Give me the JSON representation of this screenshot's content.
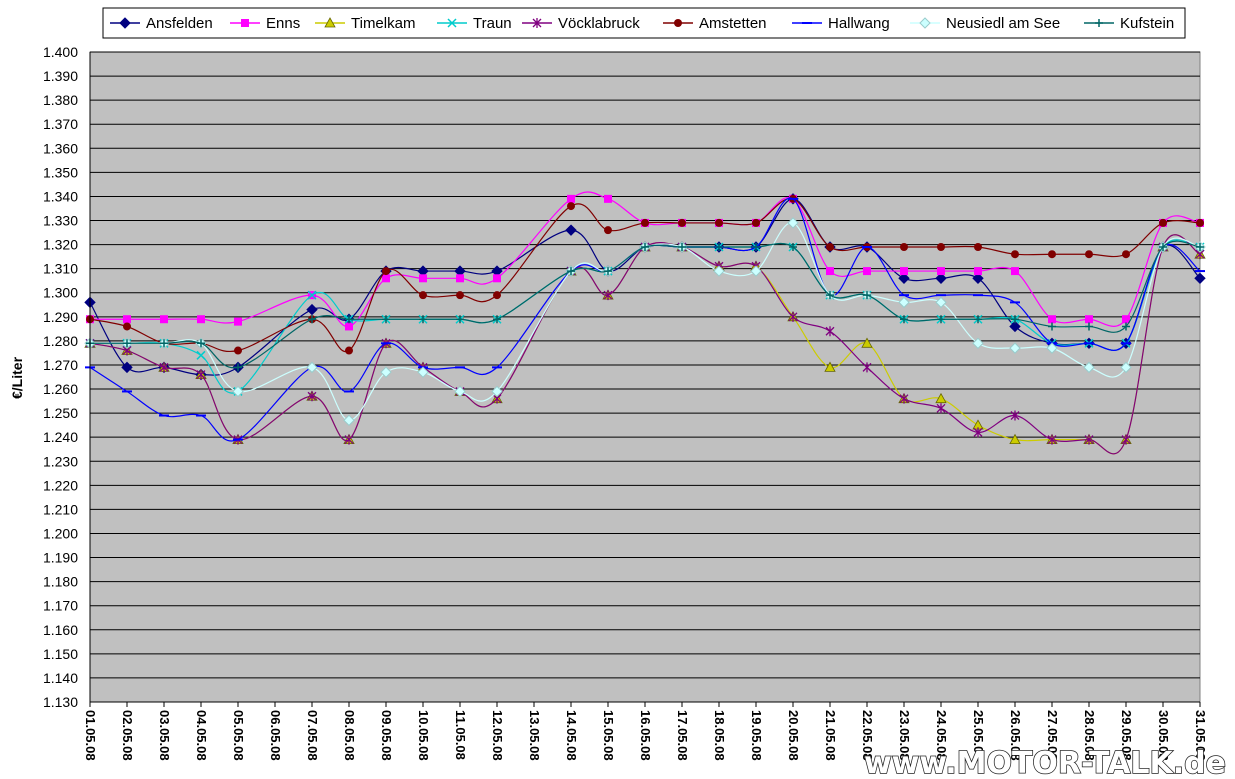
{
  "chart_data": {
    "type": "line",
    "title": "",
    "xlabel": "",
    "ylabel": "€/Liter",
    "ylim": [
      1.13,
      1.4
    ],
    "y_step": 0.01,
    "grid": true,
    "legend": "top",
    "watermark": "www.MOTOR-TALK.de",
    "x": [
      "01.05.08",
      "02.05.08",
      "03.05.08",
      "04.05.08",
      "05.05.08",
      "06.05.08",
      "07.05.08",
      "08.05.08",
      "09.05.08",
      "10.05.08",
      "11.05.08",
      "12.05.08",
      "13.05.08",
      "14.05.08",
      "15.05.08",
      "16.05.08",
      "17.05.08",
      "18.05.08",
      "19.05.08",
      "20.05.08",
      "21.05.08",
      "22.05.08",
      "23.05.08",
      "24.05.08",
      "25.05.08",
      "26.05.08",
      "27.05.08",
      "28.05.08",
      "29.05.08",
      "30.05.08",
      "31.05.08"
    ],
    "series": [
      {
        "name": "Ansfelden",
        "color": "#000080",
        "marker": "diamond",
        "values": [
          1.296,
          1.269,
          1.269,
          1.266,
          1.269,
          null,
          1.293,
          1.289,
          1.309,
          1.309,
          1.309,
          1.309,
          null,
          1.326,
          1.309,
          1.319,
          1.319,
          1.319,
          1.319,
          1.339,
          1.319,
          1.319,
          1.306,
          1.306,
          1.306,
          1.286,
          1.279,
          1.279,
          1.279,
          1.319,
          1.306
        ]
      },
      {
        "name": "Enns",
        "color": "#ff00ff",
        "marker": "square",
        "values": [
          1.289,
          1.289,
          1.289,
          1.289,
          1.288,
          null,
          1.299,
          1.286,
          1.306,
          1.306,
          1.306,
          1.306,
          null,
          1.339,
          1.339,
          1.329,
          1.329,
          1.329,
          1.329,
          1.339,
          1.309,
          1.309,
          1.309,
          1.309,
          1.309,
          1.309,
          1.289,
          1.289,
          1.289,
          1.329,
          1.329
        ]
      },
      {
        "name": "Timelkam",
        "color": "#cccc00",
        "marker": "triangle",
        "values": [
          1.279,
          1.276,
          1.269,
          1.266,
          1.239,
          null,
          1.257,
          1.239,
          1.279,
          1.269,
          1.259,
          1.256,
          null,
          1.309,
          1.299,
          1.319,
          1.319,
          1.311,
          1.311,
          1.29,
          1.269,
          1.279,
          1.256,
          1.256,
          1.245,
          1.239,
          1.239,
          1.239,
          1.239,
          1.319,
          1.316
        ]
      },
      {
        "name": "Traun",
        "color": "#00cccc",
        "marker": "x",
        "values": [
          1.279,
          1.279,
          1.279,
          1.274,
          1.259,
          null,
          1.299,
          1.289,
          1.289,
          1.289,
          1.289,
          1.289,
          null,
          1.309,
          1.309,
          1.319,
          1.319,
          1.319,
          1.319,
          1.319,
          1.299,
          1.299,
          1.289,
          1.289,
          1.289,
          1.289,
          1.279,
          1.279,
          1.279,
          1.319,
          1.319
        ]
      },
      {
        "name": "Vöcklabruck",
        "color": "#800080",
        "marker": "star",
        "values": [
          1.279,
          1.276,
          1.269,
          1.266,
          1.239,
          null,
          1.257,
          1.239,
          1.279,
          1.269,
          1.259,
          1.256,
          null,
          1.309,
          1.299,
          1.319,
          1.319,
          1.311,
          1.311,
          1.29,
          1.284,
          1.269,
          1.256,
          1.252,
          1.242,
          1.249,
          1.239,
          1.239,
          1.239,
          1.319,
          1.316
        ]
      },
      {
        "name": "Amstetten",
        "color": "#800000",
        "marker": "circle",
        "values": [
          1.289,
          1.286,
          1.279,
          1.279,
          1.276,
          null,
          1.289,
          1.276,
          1.309,
          1.299,
          1.299,
          1.299,
          null,
          1.336,
          1.326,
          1.329,
          1.329,
          1.329,
          1.329,
          1.339,
          1.319,
          1.319,
          1.319,
          1.319,
          1.319,
          1.316,
          1.316,
          1.316,
          1.316,
          1.329,
          1.329
        ]
      },
      {
        "name": "Hallwang",
        "color": "#0000ff",
        "marker": "dash",
        "values": [
          1.269,
          1.259,
          1.249,
          1.249,
          1.239,
          null,
          1.269,
          1.259,
          1.279,
          1.269,
          1.269,
          1.269,
          null,
          1.309,
          1.309,
          1.319,
          1.319,
          1.319,
          1.319,
          1.339,
          1.299,
          1.319,
          1.299,
          1.299,
          1.299,
          1.296,
          1.279,
          1.279,
          1.279,
          1.319,
          1.309
        ]
      },
      {
        "name": "Neusiedl am See",
        "color": "#ccffff",
        "marker": "diamond",
        "values": [
          1.279,
          1.279,
          1.279,
          1.279,
          1.259,
          null,
          1.269,
          1.247,
          1.267,
          1.267,
          1.259,
          1.259,
          null,
          1.309,
          1.309,
          1.319,
          1.319,
          1.309,
          1.309,
          1.329,
          1.299,
          1.299,
          1.296,
          1.296,
          1.279,
          1.277,
          1.277,
          1.269,
          1.269,
          1.319,
          1.319
        ]
      },
      {
        "name": "Kufstein",
        "color": "#006666",
        "marker": "plus",
        "values": [
          1.279,
          1.279,
          1.279,
          1.279,
          1.269,
          null,
          1.289,
          1.289,
          1.289,
          1.289,
          1.289,
          1.289,
          null,
          1.309,
          1.309,
          1.319,
          1.319,
          1.319,
          1.319,
          1.319,
          1.299,
          1.299,
          1.289,
          1.289,
          1.289,
          1.289,
          1.286,
          1.286,
          1.286,
          1.319,
          1.319
        ]
      }
    ]
  }
}
